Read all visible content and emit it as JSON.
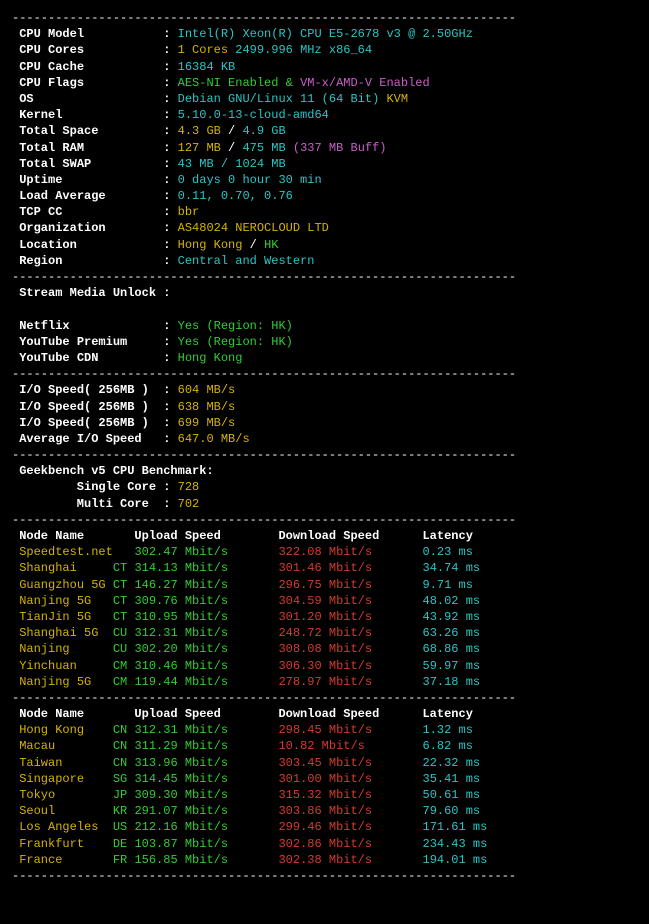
{
  "hr": "----------------------------------------------------------------------",
  "sysinfo": [
    {
      "label": "CPU Model",
      "parts": [
        {
          "text": "Intel(R) Xeon(R) CPU E5-2678 v3 @ 2.50GHz",
          "class": "cyan"
        }
      ]
    },
    {
      "label": "CPU Cores",
      "parts": [
        {
          "text": "1 Cores",
          "class": "yellow"
        },
        {
          "text": " 2499.996 MHz x86_64",
          "class": "cyan"
        }
      ]
    },
    {
      "label": "CPU Cache",
      "parts": [
        {
          "text": "16384 KB",
          "class": "cyan"
        }
      ]
    },
    {
      "label": "CPU Flags",
      "parts": [
        {
          "text": "AES-NI Enabled & ",
          "class": "green"
        },
        {
          "text": "VM-x/AMD-V Enabled",
          "class": "magenta"
        }
      ]
    },
    {
      "label": "OS",
      "parts": [
        {
          "text": "Debian GNU/Linux 11 (64 Bit)",
          "class": "cyan"
        },
        {
          "text": " KVM",
          "class": "yellow"
        }
      ]
    },
    {
      "label": "Kernel",
      "parts": [
        {
          "text": "5.10.0-13-cloud-amd64",
          "class": "cyan"
        }
      ]
    },
    {
      "label": "Total Space",
      "parts": [
        {
          "text": "4.3 GB",
          "class": "yellow"
        },
        {
          "text": " / ",
          "class": "white"
        },
        {
          "text": "4.9 GB",
          "class": "cyan"
        }
      ]
    },
    {
      "label": "Total RAM",
      "parts": [
        {
          "text": "127 MB",
          "class": "yellow"
        },
        {
          "text": " / ",
          "class": "white"
        },
        {
          "text": "475 MB",
          "class": "cyan"
        },
        {
          "text": " (337 MB Buff)",
          "class": "magenta"
        }
      ]
    },
    {
      "label": "Total SWAP",
      "parts": [
        {
          "text": "43 MB / 1024 MB",
          "class": "cyan"
        }
      ]
    },
    {
      "label": "Uptime",
      "parts": [
        {
          "text": "0 days 0 hour 30 min",
          "class": "cyan"
        }
      ]
    },
    {
      "label": "Load Average",
      "parts": [
        {
          "text": "0.11, 0.70, 0.76",
          "class": "cyan"
        }
      ]
    },
    {
      "label": "TCP CC",
      "parts": [
        {
          "text": "bbr",
          "class": "yellow"
        }
      ]
    },
    {
      "label": "Organization",
      "parts": [
        {
          "text": "AS48024 NEROCLOUD LTD",
          "class": "yellow"
        }
      ]
    },
    {
      "label": "Location",
      "parts": [
        {
          "text": "Hong Kong",
          "class": "yellow"
        },
        {
          "text": " / ",
          "class": "white"
        },
        {
          "text": "HK",
          "class": "green"
        }
      ]
    },
    {
      "label": "Region",
      "parts": [
        {
          "text": "Central and Western",
          "class": "cyan"
        }
      ]
    }
  ],
  "stream": {
    "header": "Stream Media Unlock",
    "rows": [
      {
        "label": "Netflix",
        "parts": [
          {
            "text": "Yes (Region: HK)",
            "class": "green"
          }
        ]
      },
      {
        "label": "YouTube Premium",
        "parts": [
          {
            "text": "Yes (Region: HK)",
            "class": "green"
          }
        ]
      },
      {
        "label": "YouTube CDN",
        "parts": [
          {
            "text": "Hong Kong",
            "class": "green"
          }
        ]
      }
    ]
  },
  "io": [
    {
      "label": "I/O Speed( 256MB )",
      "parts": [
        {
          "text": "604 MB/s",
          "class": "yellow"
        }
      ]
    },
    {
      "label": "I/O Speed( 256MB )",
      "parts": [
        {
          "text": "638 MB/s",
          "class": "yellow"
        }
      ]
    },
    {
      "label": "I/O Speed( 256MB )",
      "parts": [
        {
          "text": "699 MB/s",
          "class": "yellow"
        }
      ]
    },
    {
      "label": "Average I/O Speed",
      "parts": [
        {
          "text": "647.0 MB/s",
          "class": "yellow"
        }
      ]
    }
  ],
  "geekbench": {
    "header": "Geekbench v5 CPU Benchmark:",
    "rows": [
      {
        "label": "Single Core",
        "value": "728"
      },
      {
        "label": "Multi Core",
        "value": "702"
      }
    ]
  },
  "speedtest_headers": {
    "node": "Node Name",
    "upload": "Upload Speed",
    "download": "Download Speed",
    "latency": "Latency"
  },
  "speedtest1": [
    {
      "node": "Speedtest.net",
      "cc": "",
      "upload": "302.47 Mbit/s",
      "download": "322.08 Mbit/s",
      "latency": "0.23 ms"
    },
    {
      "node": "Shanghai",
      "cc": "CT",
      "upload": "314.13 Mbit/s",
      "download": "301.46 Mbit/s",
      "latency": "34.74 ms"
    },
    {
      "node": "Guangzhou 5G",
      "cc": "CT",
      "upload": "146.27 Mbit/s",
      "download": "296.75 Mbit/s",
      "latency": "9.71 ms"
    },
    {
      "node": "Nanjing 5G",
      "cc": "CT",
      "upload": "309.76 Mbit/s",
      "download": "304.59 Mbit/s",
      "latency": "48.02 ms"
    },
    {
      "node": "TianJin 5G",
      "cc": "CT",
      "upload": "310.95 Mbit/s",
      "download": "301.20 Mbit/s",
      "latency": "43.92 ms"
    },
    {
      "node": "Shanghai 5G",
      "cc": "CU",
      "upload": "312.31 Mbit/s",
      "download": "248.72 Mbit/s",
      "latency": "63.26 ms"
    },
    {
      "node": "Nanjing",
      "cc": "CU",
      "upload": "302.20 Mbit/s",
      "download": "308.08 Mbit/s",
      "latency": "68.86 ms"
    },
    {
      "node": "Yinchuan",
      "cc": "CM",
      "upload": "310.46 Mbit/s",
      "download": "306.30 Mbit/s",
      "latency": "59.97 ms"
    },
    {
      "node": "Nanjing 5G",
      "cc": "CM",
      "upload": "119.44 Mbit/s",
      "download": "278.97 Mbit/s",
      "latency": "37.18 ms"
    }
  ],
  "speedtest2": [
    {
      "node": "Hong Kong",
      "cc": "CN",
      "upload": "312.31 Mbit/s",
      "download": "298.45 Mbit/s",
      "latency": "1.32 ms"
    },
    {
      "node": "Macau",
      "cc": "CN",
      "upload": "311.29 Mbit/s",
      "download": "10.82 Mbit/s",
      "latency": "6.82 ms"
    },
    {
      "node": "Taiwan",
      "cc": "CN",
      "upload": "313.96 Mbit/s",
      "download": "303.45 Mbit/s",
      "latency": "22.32 ms"
    },
    {
      "node": "Singapore",
      "cc": "SG",
      "upload": "314.45 Mbit/s",
      "download": "301.00 Mbit/s",
      "latency": "35.41 ms"
    },
    {
      "node": "Tokyo",
      "cc": "JP",
      "upload": "309.30 Mbit/s",
      "download": "315.32 Mbit/s",
      "latency": "50.61 ms"
    },
    {
      "node": "Seoul",
      "cc": "KR",
      "upload": "291.07 Mbit/s",
      "download": "303.86 Mbit/s",
      "latency": "79.60 ms"
    },
    {
      "node": "Los Angeles",
      "cc": "US",
      "upload": "212.16 Mbit/s",
      "download": "299.46 Mbit/s",
      "latency": "171.61 ms"
    },
    {
      "node": "Frankfurt",
      "cc": "DE",
      "upload": "103.87 Mbit/s",
      "download": "302.86 Mbit/s",
      "latency": "234.43 ms"
    },
    {
      "node": "France",
      "cc": "FR",
      "upload": "156.85 Mbit/s",
      "download": "302.38 Mbit/s",
      "latency": "194.01 ms"
    }
  ]
}
